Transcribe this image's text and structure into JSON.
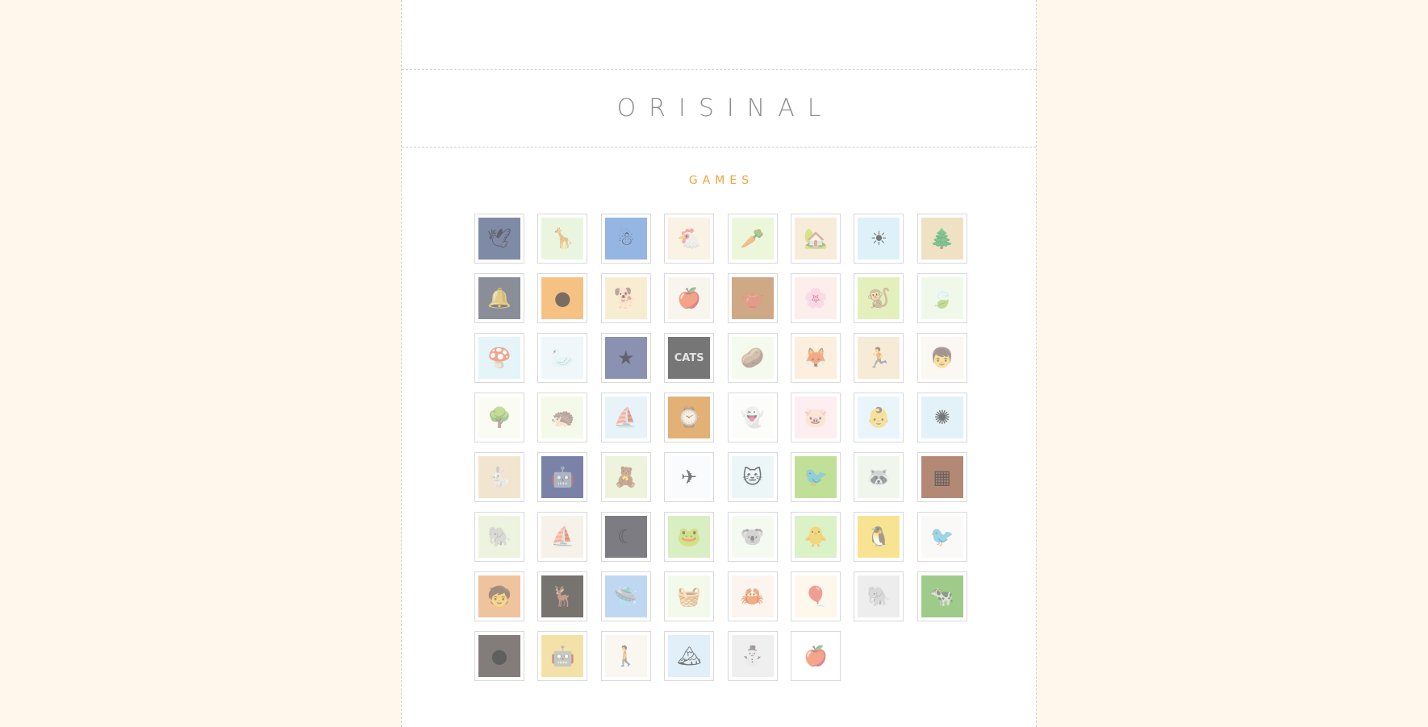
{
  "site": {
    "logo": "ORISINAL"
  },
  "section": {
    "title": "GAMES"
  },
  "games": [
    {
      "icon": "blue-bird-icon",
      "glyph": "🕊",
      "bg": "#3b4c78"
    },
    {
      "icon": "giraffe-icon",
      "glyph": "🦒",
      "bg": "#dff0cf"
    },
    {
      "icon": "blue-creature-icon",
      "glyph": "☃",
      "bg": "#5d8fd4"
    },
    {
      "icon": "chicken-icon",
      "glyph": "🐔",
      "bg": "#f6ecd7"
    },
    {
      "icon": "carrot-icon",
      "glyph": "🥕",
      "bg": "#e2f1c6"
    },
    {
      "icon": "cottage-icon",
      "glyph": "🏡",
      "bg": "#f1e2c5"
    },
    {
      "icon": "sun-icon",
      "glyph": "☀",
      "bg": "#cdeaf4"
    },
    {
      "icon": "forest-light-icon",
      "glyph": "🌲",
      "bg": "#e7d1a3"
    },
    {
      "icon": "bell-icon",
      "glyph": "🔔",
      "bg": "#4c5263"
    },
    {
      "icon": "orange-ball-icon",
      "glyph": "●",
      "bg": "#f0a142"
    },
    {
      "icon": "puppy-icon",
      "glyph": "🐕",
      "bg": "#f5e2b9"
    },
    {
      "icon": "window-apple-icon",
      "glyph": "🍎",
      "bg": "#f4f0e6"
    },
    {
      "icon": "teapot-icon",
      "glyph": "🫖",
      "bg": "#b57c44"
    },
    {
      "icon": "pink-flower-icon",
      "glyph": "🌸",
      "bg": "#fbe7e1"
    },
    {
      "icon": "monkey-icon",
      "glyph": "🐒",
      "bg": "#d5e89a"
    },
    {
      "icon": "leaf-bug-icon",
      "glyph": "🍃",
      "bg": "#e9f5df"
    },
    {
      "icon": "winged-mushroom-icon",
      "glyph": "🍄",
      "bg": "#d7eef6"
    },
    {
      "icon": "white-bird-icon",
      "glyph": "🦢",
      "bg": "#e6f3f7"
    },
    {
      "icon": "star-icon",
      "glyph": "★",
      "bg": "#4d5888"
    },
    {
      "icon": "cats-icon",
      "glyph": "CATS",
      "bg": "#2d2d2d",
      "text": true
    },
    {
      "icon": "round-creature-icon",
      "glyph": "🥔",
      "bg": "#eef7e3"
    },
    {
      "icon": "dragon-cub-icon",
      "glyph": "🦊",
      "bg": "#fae6cc"
    },
    {
      "icon": "running-boy-icon",
      "glyph": "🏃",
      "bg": "#f2e0c2"
    },
    {
      "icon": "boy-sled-icon",
      "glyph": "👦",
      "bg": "#f9f3ec"
    },
    {
      "icon": "tree-icon",
      "glyph": "🌳",
      "bg": "#f7fbef"
    },
    {
      "icon": "hedgehog-icon",
      "glyph": "🦔",
      "bg": "#eef6de"
    },
    {
      "icon": "boat-icon",
      "glyph": "⛵",
      "bg": "#dcecf6"
    },
    {
      "icon": "clock-creature-icon",
      "glyph": "⌚",
      "bg": "#d4862c"
    },
    {
      "icon": "ghost-icon",
      "glyph": "👻",
      "bg": "#fbfcf8"
    },
    {
      "icon": "pig-icon",
      "glyph": "🐷",
      "bg": "#fbe5ea"
    },
    {
      "icon": "child-icon",
      "glyph": "👶",
      "bg": "#def0f8"
    },
    {
      "icon": "sea-urchin-icon",
      "glyph": "✺",
      "bg": "#d3ecf5"
    },
    {
      "icon": "sitting-rabbit-icon",
      "glyph": "🐇",
      "bg": "#ead7b5"
    },
    {
      "icon": "night-robot-icon",
      "glyph": "🤖",
      "bg": "#353f7a"
    },
    {
      "icon": "teddy-bear-icon",
      "glyph": "🧸",
      "bg": "#e4edc9"
    },
    {
      "icon": "paper-plane-icon",
      "glyph": "✈",
      "bg": "#f6f9fb"
    },
    {
      "icon": "snow-cat-icon",
      "glyph": "🐱",
      "bg": "#e4f2f2"
    },
    {
      "icon": "hummingbird-icon",
      "glyph": "🐦",
      "bg": "#9fcf62"
    },
    {
      "icon": "raccoon-icon",
      "glyph": "🦝",
      "bg": "#e9f2e0"
    },
    {
      "icon": "color-blocks-icon",
      "glyph": "▦",
      "bg": "#8a4a2d"
    },
    {
      "icon": "elephant-icon",
      "glyph": "🐘",
      "bg": "#e4edcd"
    },
    {
      "icon": "sailing-ship-icon",
      "glyph": "⛵",
      "bg": "#f1ebdd"
    },
    {
      "icon": "crescent-moon-icon",
      "glyph": "☾",
      "bg": "#36363f"
    },
    {
      "icon": "frog-icon",
      "glyph": "🐸",
      "bg": "#c6e5a5"
    },
    {
      "icon": "koala-icon",
      "glyph": "🐨",
      "bg": "#f0f8ea"
    },
    {
      "icon": "chicks-umbrella-icon",
      "glyph": "🐥",
      "bg": "#c8eaa8"
    },
    {
      "icon": "yellow-bird-icon",
      "glyph": "🐧",
      "bg": "#f4d45a"
    },
    {
      "icon": "pink-bird-icon",
      "glyph": "🐦",
      "bg": "#f9f4f5"
    },
    {
      "icon": "boy-portrait-icon",
      "glyph": "🧒",
      "bg": "#e7a36a"
    },
    {
      "icon": "reindeer-icon",
      "glyph": "🦌",
      "bg": "#2f2822"
    },
    {
      "icon": "ufo-icon",
      "glyph": "🛸",
      "bg": "#9ec2ec"
    },
    {
      "icon": "start-basket-icon",
      "glyph": "🧺",
      "bg": "#eef8e1"
    },
    {
      "icon": "crab-icon",
      "glyph": "🦀",
      "bg": "#f9efe6"
    },
    {
      "icon": "hot-air-balloon-icon",
      "glyph": "🎈",
      "bg": "#fdf3e2"
    },
    {
      "icon": "grey-elephant-icon",
      "glyph": "🐘",
      "bg": "#e3e3e3"
    },
    {
      "icon": "cow-icon",
      "glyph": "🐄",
      "bg": "#6bb04c"
    },
    {
      "icon": "red-sphere-icon",
      "glyph": "●",
      "bg": "#403733"
    },
    {
      "icon": "blue-robot-icon",
      "glyph": "🤖",
      "bg": "#efd17a"
    },
    {
      "icon": "walking-man-icon",
      "glyph": "🚶",
      "bg": "#f7f1e9"
    },
    {
      "icon": "snowy-mountains-icon",
      "glyph": "🏔",
      "bg": "#cfe7f4"
    },
    {
      "icon": "snowman-icon",
      "glyph": "⛄",
      "bg": "#e7e7e7"
    },
    {
      "icon": "red-apple-icon",
      "glyph": "🍎",
      "bg": "#ffffff"
    }
  ]
}
